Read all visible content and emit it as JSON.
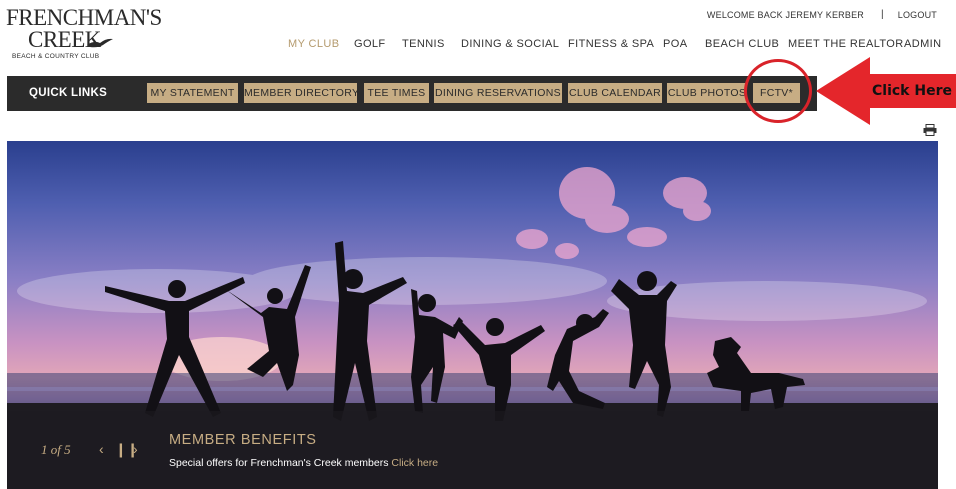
{
  "logo": {
    "line1": "FRENCHMAN'S",
    "line2": "CREEK",
    "line3": "BEACH & COUNTRY CLUB"
  },
  "account": {
    "welcome": "WELCOME BACK JEREMY KERBER",
    "separator": "|",
    "logout": "LOGOUT"
  },
  "nav": {
    "items": [
      "MY CLUB",
      "GOLF",
      "TENNIS",
      "DINING & SOCIAL",
      "FITNESS & SPA",
      "POA",
      "BEACH CLUB",
      "MEET THE REALTOR",
      "ADMIN"
    ],
    "active": "MY CLUB",
    "active_color": "#b49a6d"
  },
  "quick_links": {
    "title": "QUICK LINKS",
    "buttons": [
      "MY STATEMENT",
      "MEMBER DIRECTORY",
      "TEE TIMES",
      "DINING RESERVATIONS",
      "CLUB CALENDAR",
      "CLUB PHOTOS",
      "FCTV*"
    ],
    "button_color": "#c7ad84",
    "bar_color": "#2b2b2b"
  },
  "annotation": {
    "label": "Click Here",
    "color": "#e4262b"
  },
  "icons": {
    "print": "print-icon",
    "prev": "chevron-left-icon",
    "pause": "pause-icon",
    "next": "chevron-right-icon"
  },
  "hero": {
    "counter": "1 of 5",
    "title": "MEMBER BENEFITS",
    "text": "Special offers for Frenchman's Creek members ",
    "link": "Click here"
  }
}
